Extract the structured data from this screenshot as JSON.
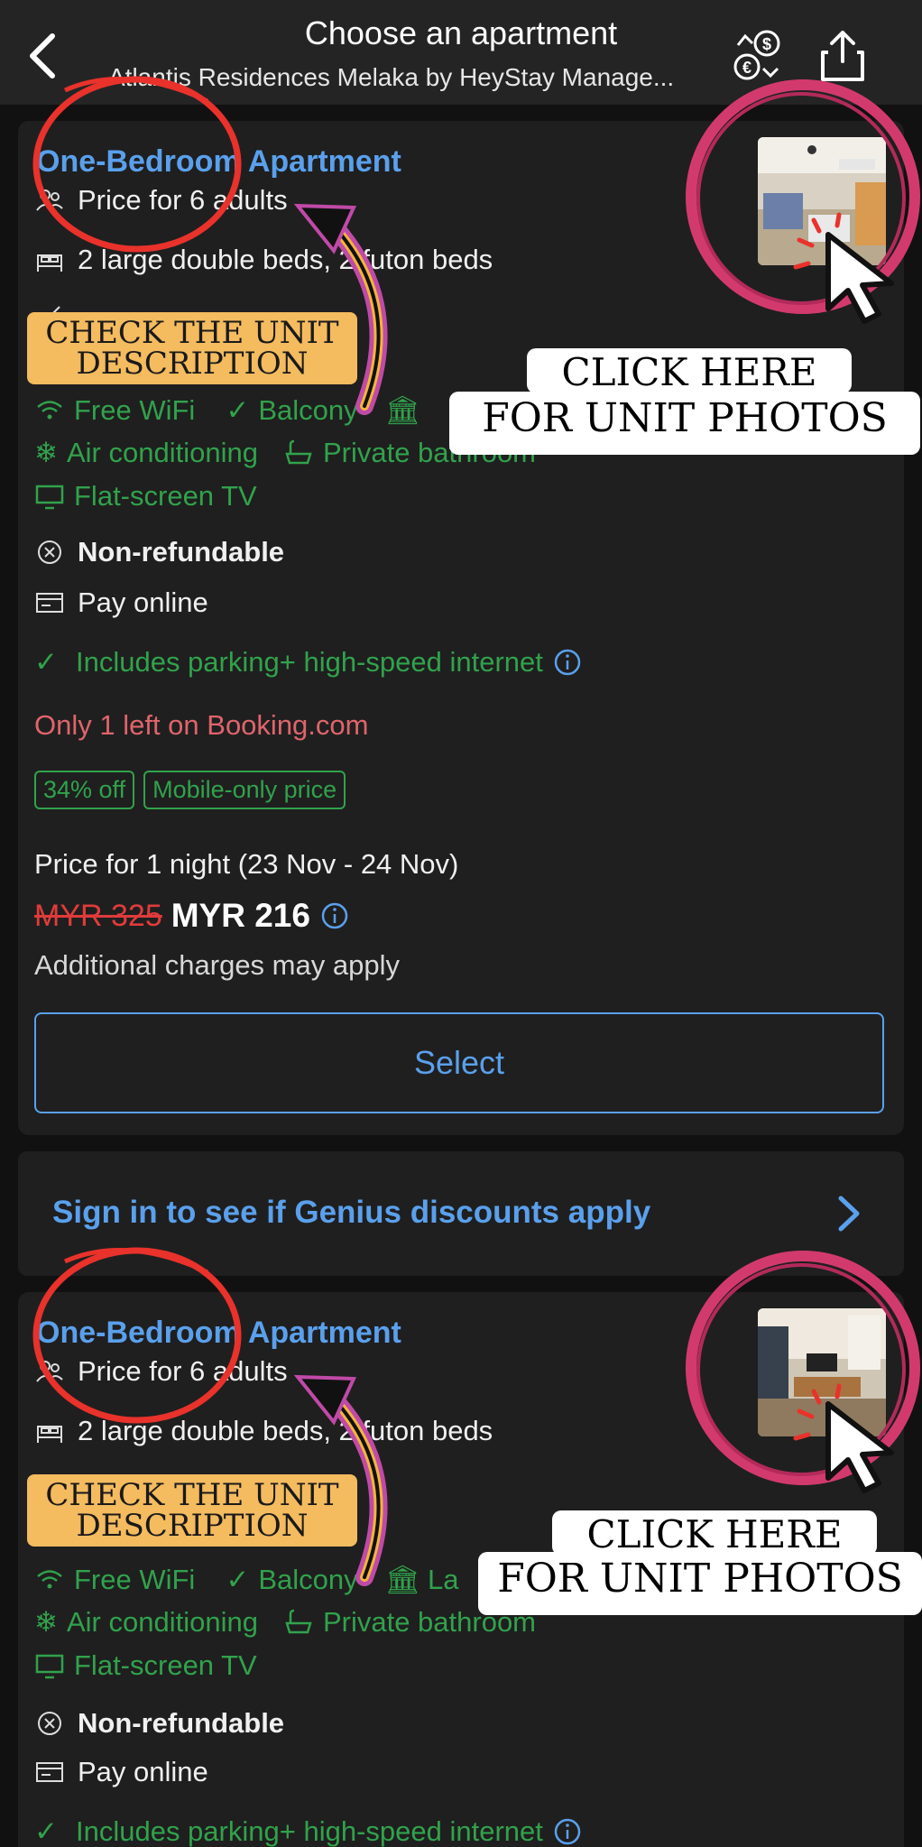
{
  "header": {
    "title": "Choose an apartment",
    "subtitle": "Atlantis Residences Melaka by HeyStay Manage..."
  },
  "cards": [
    {
      "room_title": "One-Bedroom Apartment",
      "occupancy": "Price for 6 adults",
      "beds": "2 large double beds, 2 futon beds",
      "facilities_row1": [
        "Free WiFi",
        "Balcony"
      ],
      "facilities_row2": [
        "Air conditioning",
        "Private bathroom"
      ],
      "facilities_row3": [
        "Flat-screen TV"
      ],
      "refund_policy": "Non-refundable",
      "payment": "Pay online",
      "includes": "Includes parking+ high-speed internet",
      "availability": "Only 1 left on Booking.com",
      "badges": [
        "34% off",
        "Mobile-only price"
      ],
      "price_period": "Price for 1 night (23 Nov - 24 Nov)",
      "old_price": "MYR 325",
      "new_price": "MYR 216",
      "extra_charges": "Additional charges may apply",
      "select_label": "Select"
    },
    {
      "room_title": "One-Bedroom Apartment",
      "occupancy": "Price for 6 adults",
      "beds": "2 large double beds, 2 futon beds",
      "facilities_row1": [
        "Free WiFi",
        "Balcony",
        "La"
      ],
      "facilities_row2": [
        "Air conditioning",
        "Private bathroom"
      ],
      "facilities_row3": [
        "Flat-screen TV"
      ],
      "refund_policy": "Non-refundable",
      "payment": "Pay online",
      "includes": "Includes parking+ high-speed internet"
    }
  ],
  "genius_banner": "Sign in to see if Genius discounts apply",
  "annotations": {
    "unit_tag_line1": "CHECK THE UNIT",
    "unit_tag_line2": "DESCRIPTION",
    "photos_line1": "CLICK HERE",
    "photos_line2": "FOR UNIT PHOTOS"
  },
  "colors": {
    "link_blue": "#5aa0ec",
    "facility_green": "#31a24c",
    "urgency_red": "#e0646c",
    "strike_red": "#e03b3b",
    "tag_orange": "#f4bb5f",
    "circle_red": "#e8322b",
    "swoosh_pink": "#c04aa8"
  }
}
